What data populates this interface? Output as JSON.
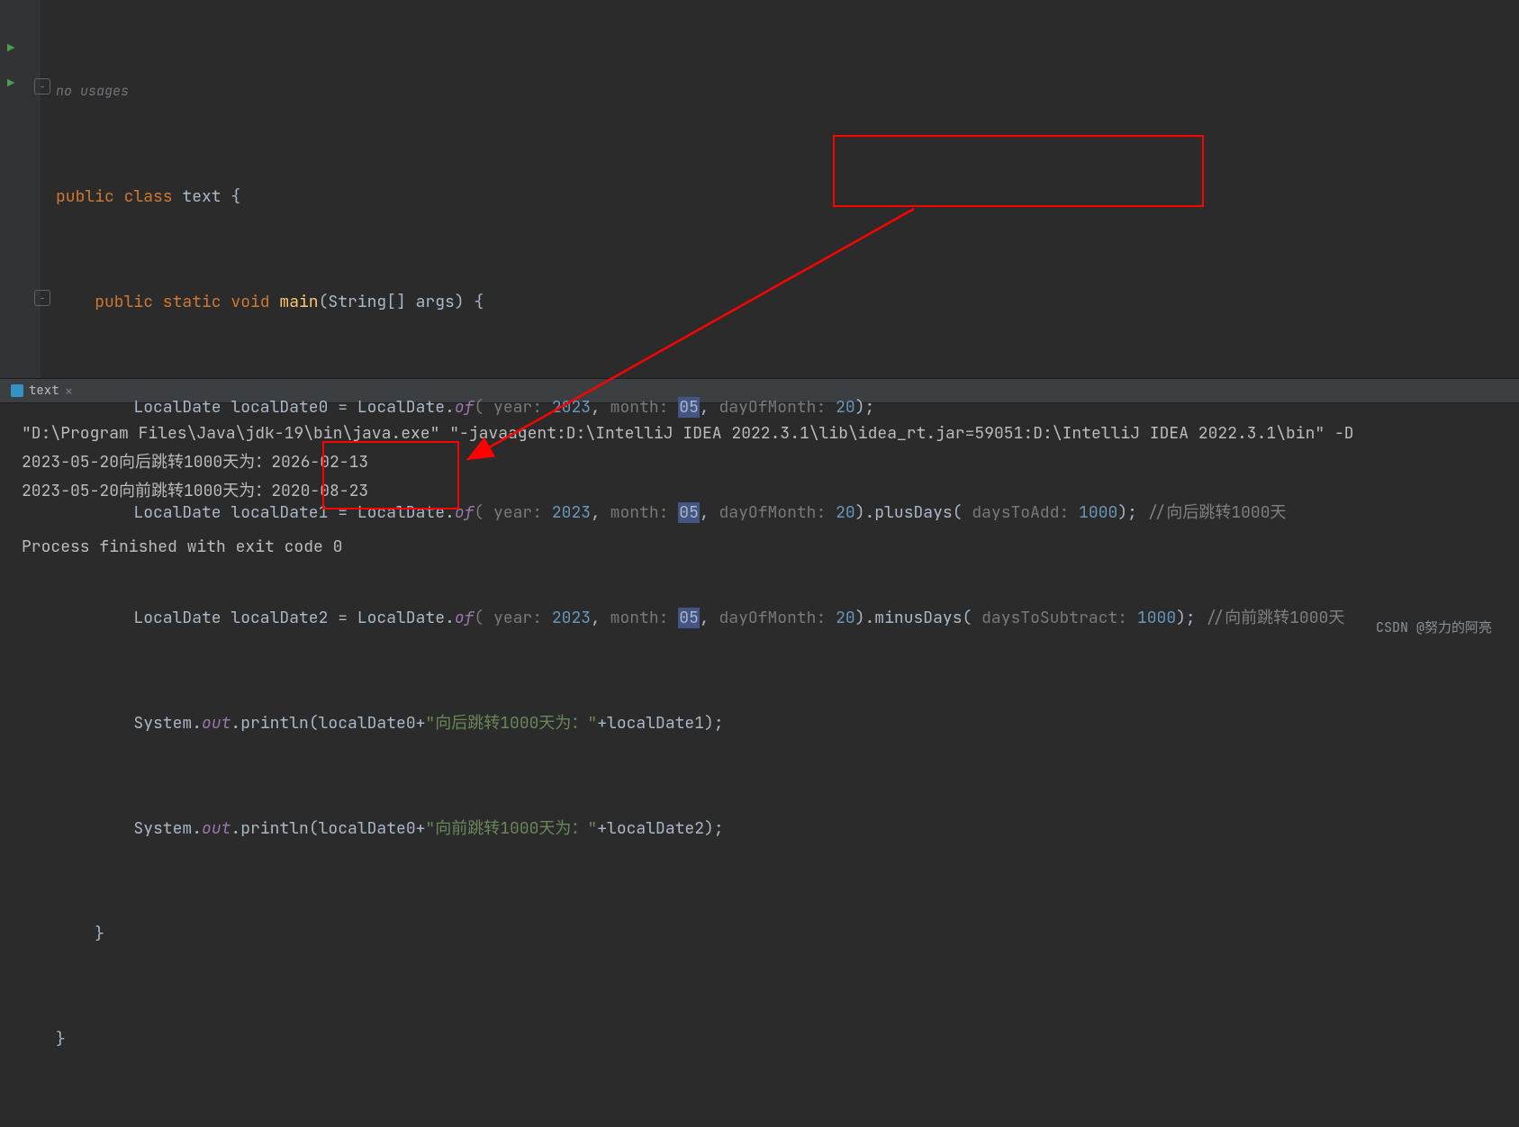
{
  "editor": {
    "usages_hint": "no usages",
    "class_decl": {
      "kw1": "public class ",
      "name": "text",
      "brace": " {"
    },
    "main_decl": {
      "kw": "public static void ",
      "name": "main",
      "params": "(String[] args) {"
    },
    "local0": {
      "prefix": "LocalDate localDate0 = LocalDate.",
      "of": "of",
      "open": "( ",
      "h_year": "year: ",
      "year": "2023",
      "c1": ", ",
      "h_month": "month: ",
      "month": "05",
      "c2": ", ",
      "h_dom": "dayOfMonth: ",
      "dom": "20",
      "close": ");"
    },
    "local1": {
      "prefix": "LocalDate localDate1 = LocalDate.",
      "of": "of",
      "open": "( ",
      "h_year": "year: ",
      "year": "2023",
      "c1": ", ",
      "h_month": "month: ",
      "month": "05",
      "c2": ", ",
      "h_dom": "dayOfMonth: ",
      "dom": "20",
      "mid": ").plusDays( ",
      "h_add": "daysToAdd: ",
      "add": "1000",
      "close": "); ",
      "comment": "//向后跳转1000天"
    },
    "local2": {
      "prefix": "LocalDate localDate2 = LocalDate.",
      "of": "of",
      "open": "( ",
      "h_year": "year: ",
      "year": "2023",
      "c1": ", ",
      "h_month": "month: ",
      "month": "05",
      "c2": ", ",
      "h_dom": "dayOfMonth: ",
      "dom": "20",
      "mid": ").minusDays( ",
      "h_sub": "daysToSubtract: ",
      "sub": "1000",
      "close": "); ",
      "comment": "//向前跳转1000天"
    },
    "print1": {
      "a": "System.",
      "out": "out",
      "b": ".println(localDate0+",
      "s": "\"向后跳转1000天为：\"",
      "c": "+localDate1);"
    },
    "print2": {
      "a": "System.",
      "out": "out",
      "b": ".println(localDate0+",
      "s": "\"向前跳转1000天为：\"",
      "c": "+localDate2);"
    },
    "close_brace": "}"
  },
  "tab": {
    "label": "text"
  },
  "console": {
    "cmd": "\"D:\\Program Files\\Java\\jdk-19\\bin\\java.exe\" \"-javaagent:D:\\IntelliJ IDEA 2022.3.1\\lib\\idea_rt.jar=59051:D:\\IntelliJ IDEA 2022.3.1\\bin\" -D",
    "out1_pre": "2023-05-20向后跳转1000天为：",
    "out1_val": "2026-02-13",
    "out2_pre": "2023-05-20向前跳转1000天为：",
    "out2_val": "2020-08-23",
    "exit": "Process finished with exit code 0"
  },
  "watermark": "CSDN @努力的阿亮"
}
